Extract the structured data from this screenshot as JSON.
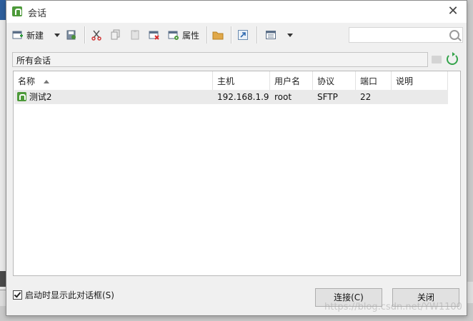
{
  "window": {
    "title": "会话"
  },
  "toolbar": {
    "new_label": "新建",
    "properties_label": "属性"
  },
  "search": {
    "value": "",
    "placeholder": ""
  },
  "path": {
    "text": "所有会话"
  },
  "table": {
    "columns": [
      "名称",
      "主机",
      "用户名",
      "协议",
      "端口",
      "说明"
    ],
    "rows": [
      {
        "name": "测试2",
        "host": "192.168.1.9",
        "user": "root",
        "protocol": "SFTP",
        "port": "22",
        "desc": ""
      }
    ]
  },
  "footer": {
    "startup_checkbox_label": "启动时显示此对话框(S)",
    "startup_checked": true,
    "connect_label": "连接(C)",
    "close_label": "关闭"
  },
  "watermark": "https://blog.csdn.net/YW1100"
}
